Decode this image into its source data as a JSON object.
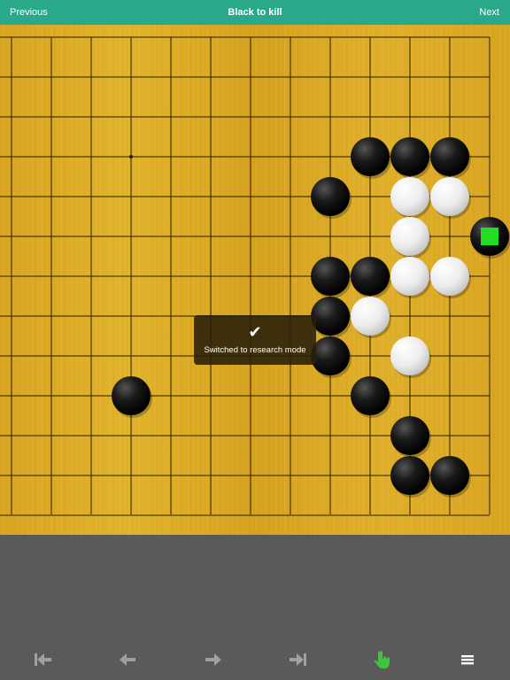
{
  "topbar": {
    "previous_label": "Previous",
    "title": "Black to kill",
    "next_label": "Next"
  },
  "toast": {
    "icon": "checkmark-icon",
    "message": "Switched to research mode"
  },
  "board": {
    "visible_columns": 13,
    "visible_rows": 13,
    "star_point": [
      3,
      3
    ],
    "stones": [
      {
        "color": "black",
        "col": 9,
        "row": 3
      },
      {
        "color": "black",
        "col": 10,
        "row": 3
      },
      {
        "color": "black",
        "col": 11,
        "row": 3
      },
      {
        "color": "black",
        "col": 8,
        "row": 4
      },
      {
        "color": "white",
        "col": 10,
        "row": 4
      },
      {
        "color": "white",
        "col": 11,
        "row": 4
      },
      {
        "color": "black",
        "col": 12,
        "row": 5,
        "marker": "square"
      },
      {
        "color": "white",
        "col": 10,
        "row": 5
      },
      {
        "color": "black",
        "col": 8,
        "row": 6
      },
      {
        "color": "black",
        "col": 9,
        "row": 6
      },
      {
        "color": "white",
        "col": 10,
        "row": 6
      },
      {
        "color": "white",
        "col": 11,
        "row": 6
      },
      {
        "color": "black",
        "col": 8,
        "row": 7
      },
      {
        "color": "white",
        "col": 9,
        "row": 7
      },
      {
        "color": "black",
        "col": 8,
        "row": 8
      },
      {
        "color": "white",
        "col": 10,
        "row": 8
      },
      {
        "color": "black",
        "col": 3,
        "row": 9
      },
      {
        "color": "black",
        "col": 9,
        "row": 9
      },
      {
        "color": "black",
        "col": 10,
        "row": 10
      },
      {
        "color": "black",
        "col": 10,
        "row": 11
      },
      {
        "color": "black",
        "col": 11,
        "row": 11
      }
    ],
    "marker_color": "#22dd22"
  },
  "toolbar": {
    "items": [
      "first-move-icon",
      "previous-move-icon",
      "next-move-icon",
      "last-move-icon",
      "hand-pointer-icon",
      "menu-icon"
    ],
    "active_color": "#3ec63e",
    "inactive_color": "#a0a0a0"
  }
}
